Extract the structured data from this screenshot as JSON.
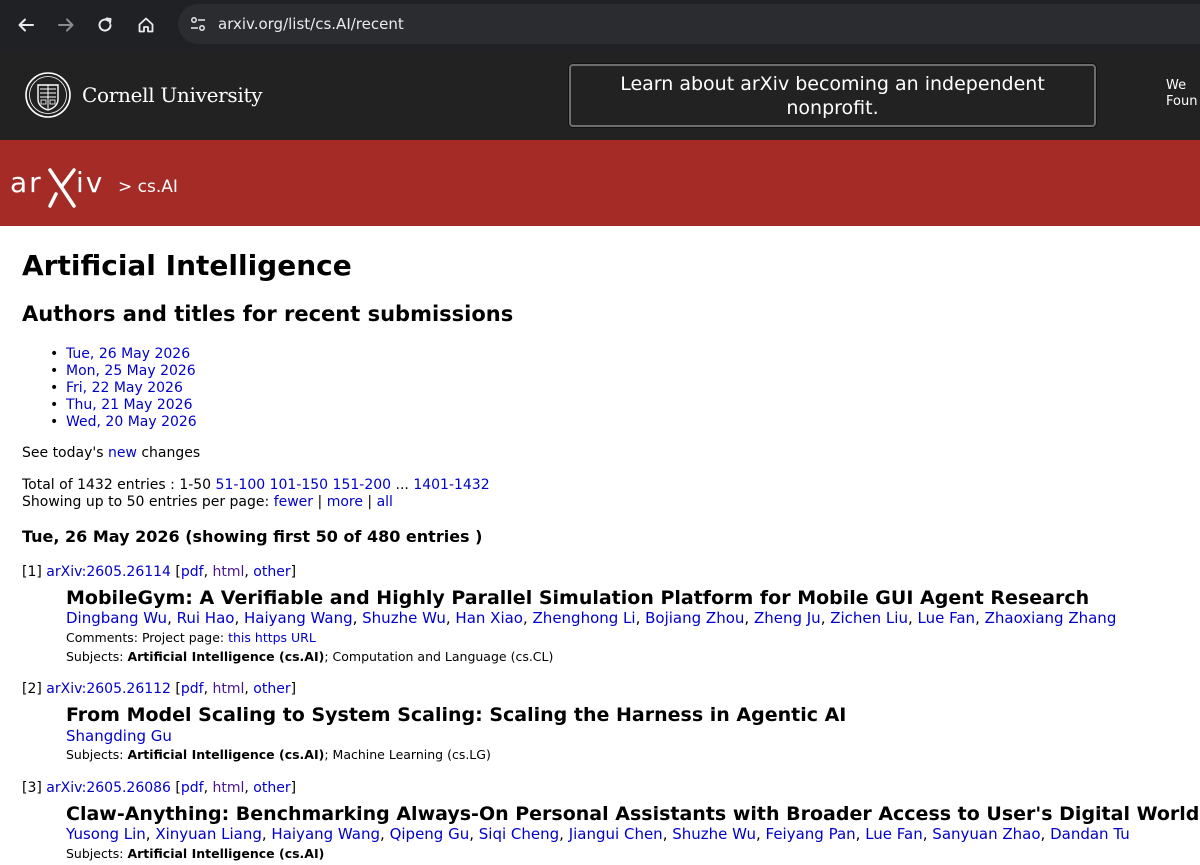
{
  "browser": {
    "url": "arxiv.org/list/cs.AI/recent",
    "back_icon": "back-arrow-icon",
    "forward_icon": "forward-arrow-icon",
    "reload_icon": "reload-icon",
    "home_icon": "home-icon",
    "site_info_icon": "site-info-icon"
  },
  "cornell": {
    "name": "Cornell University",
    "announcement": "Learn about arXiv becoming an independent nonprofit.",
    "cut_text_line1": "We",
    "cut_text_line2": "Foun"
  },
  "arxiv_bar": {
    "logo_text": "arXiv",
    "breadcrumb": "> cs.AI",
    "color": "#a42b26"
  },
  "page": {
    "title": "Artificial Intelligence",
    "subtitle": "Authors and titles for recent submissions",
    "dates": [
      "Tue, 26 May 2026",
      "Mon, 25 May 2026",
      "Fri, 22 May 2026",
      "Thu, 21 May 2026",
      "Wed, 20 May 2026"
    ],
    "see_today_prefix": "See today's",
    "see_today_link": "new",
    "see_today_suffix": "changes",
    "total_prefix": "Total of 1432 entries : 1-50",
    "page_links": [
      "51-100",
      "101-150",
      "151-200"
    ],
    "ellipsis": "...",
    "last_page_link": "1401-1432",
    "showing_prefix": "Showing up to 50 entries per page:",
    "fewer": "fewer",
    "more": "more",
    "all": "all",
    "sep": "|",
    "day_heading": "Tue, 26 May 2026 (showing first 50 of 480 entries )"
  },
  "entries": [
    {
      "index": "[1]",
      "id": "arXiv:2605.26114",
      "pdf": "pdf",
      "html": "html",
      "other": "other",
      "title": "MobileGym: A Verifiable and Highly Parallel Simulation Platform for Mobile GUI Agent Research",
      "authors": [
        "Dingbang Wu",
        "Rui Hao",
        "Haiyang Wang",
        "Shuzhe Wu",
        "Han Xiao",
        "Zhenghong Li",
        "Bojiang Zhou",
        "Zheng Ju",
        "Zichen Liu",
        "Lue Fan",
        "Zhaoxiang Zhang"
      ],
      "comments_label": "Comments:",
      "comments_text": "Project page:",
      "comments_link": "this https URL",
      "subjects_label": "Subjects:",
      "subjects_primary": "Artificial Intelligence (cs.AI)",
      "subjects_rest": "; Computation and Language (cs.CL)"
    },
    {
      "index": "[2]",
      "id": "arXiv:2605.26112",
      "pdf": "pdf",
      "html": "html",
      "other": "other",
      "title": "From Model Scaling to System Scaling: Scaling the Harness in Agentic AI",
      "authors": [
        "Shangding Gu"
      ],
      "subjects_label": "Subjects:",
      "subjects_primary": "Artificial Intelligence (cs.AI)",
      "subjects_rest": "; Machine Learning (cs.LG)"
    },
    {
      "index": "[3]",
      "id": "arXiv:2605.26086",
      "pdf": "pdf",
      "html": "html",
      "other": "other",
      "title": "Claw-Anything: Benchmarking Always-On Personal Assistants with Broader Access to User's Digital World",
      "authors": [
        "Yusong Lin",
        "Xinyuan Liang",
        "Haiyang Wang",
        "Qipeng Gu",
        "Siqi Cheng",
        "Jiangui Chen",
        "Shuzhe Wu",
        "Feiyang Pan",
        "Lue Fan",
        "Sanyuan Zhao",
        "Dandan Tu"
      ],
      "subjects_label": "Subjects:",
      "subjects_primary": "Artificial Intelligence (cs.AI)",
      "subjects_rest": ""
    }
  ]
}
